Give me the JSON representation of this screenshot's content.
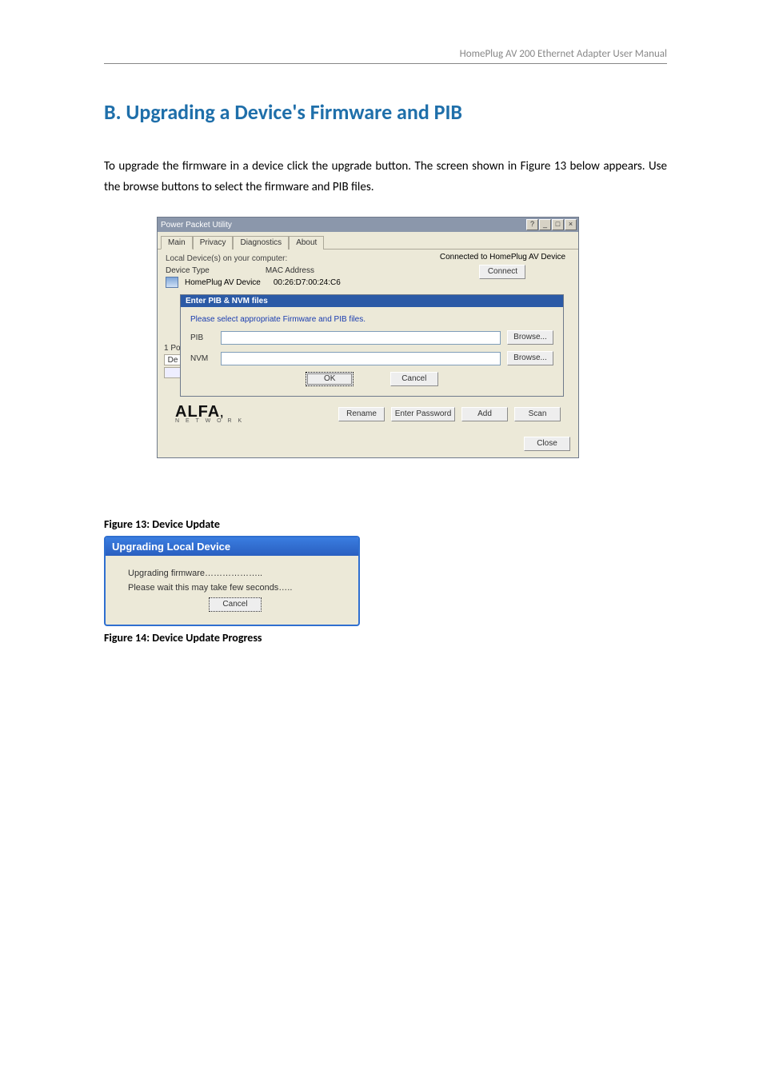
{
  "header": {
    "doc_title": "HomePlug AV 200 Ethernet Adapter  User Manual"
  },
  "heading": "B. Upgrading a Device's Firmware and PIB",
  "paragraph": "To upgrade the firmware in a device click the upgrade button. The screen shown in Figure 13 below appears. Use the browse buttons to select the firmware and PIB files.",
  "fig13": {
    "window_title": "Power Packet Utility",
    "tabs": {
      "main": "Main",
      "privacy": "Privacy",
      "diagnostics": "Diagnostics",
      "about": "About"
    },
    "subtext": "Local Device(s) on your computer:",
    "col_device_type": "Device Type",
    "col_mac": "MAC Address",
    "dev_type": "HomePlug AV Device",
    "dev_mac": "00:26:D7:00:24:C6",
    "connected_label": "Connected to HomePlug AV Device",
    "connect_btn": "Connect",
    "left_frag_1": "1 Po",
    "left_frag_2": "De",
    "dlg_title": "Enter PIB & NVM files",
    "dlg_hint": "Please select appropriate Firmware and PIB files.",
    "pib_label": "PIB",
    "nvm_label": "NVM",
    "browse_btn": "Browse...",
    "ok_btn": "OK",
    "cancel_btn": "Cancel",
    "logo_main": "ALFA",
    "logo_sub": "N E T W O R K",
    "rename_btn": "Rename",
    "enter_pw_btn": "Enter Password",
    "add_btn": "Add",
    "scan_btn": "Scan",
    "close_btn": "Close"
  },
  "caption13": "Figure 13: Device Update",
  "fig14": {
    "title": "Upgrading Local Device",
    "line1": "Upgrading firmware………………..",
    "line2": "Please wait this may take few seconds…..",
    "cancel_btn": "Cancel"
  },
  "caption14": "Figure 14: Device Update Progress"
}
